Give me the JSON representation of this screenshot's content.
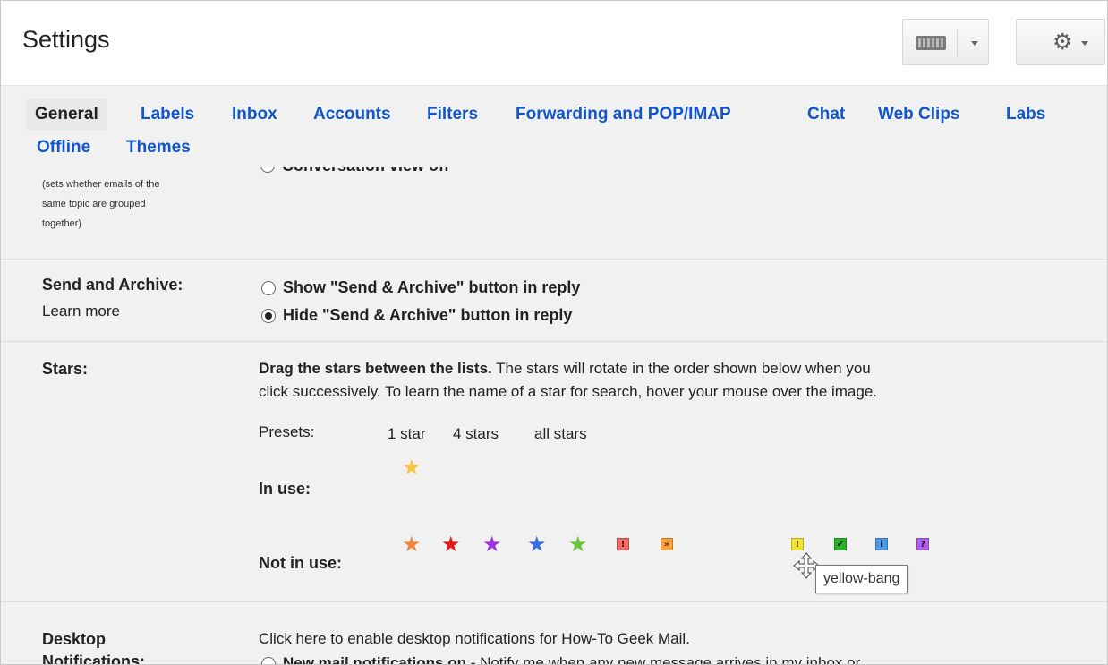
{
  "header": {
    "title": "Settings"
  },
  "icons": {
    "keyboard": "keyboard-icon",
    "gear": "gear-icon",
    "caret": "chevron-down-icon"
  },
  "tabs": [
    {
      "label": "General",
      "active": true
    },
    {
      "label": "Labels"
    },
    {
      "label": "Inbox"
    },
    {
      "label": "Accounts"
    },
    {
      "label": "Filters"
    },
    {
      "label": "Forwarding and POP/IMAP"
    },
    {
      "label": "Chat"
    },
    {
      "label": "Web Clips"
    },
    {
      "label": "Labs"
    },
    {
      "label": "Offline"
    },
    {
      "label": "Themes"
    }
  ],
  "conversation": {
    "option_cut": "Conversation view off",
    "description": [
      "(sets whether emails of the",
      "same topic are grouped",
      "together)"
    ]
  },
  "send_archive": {
    "label": "Send and Archive:",
    "learn_more": "Learn more",
    "options": [
      {
        "label": "Show \"Send & Archive\" button in reply",
        "selected": false
      },
      {
        "label": "Hide \"Send & Archive\" button in reply",
        "selected": true
      }
    ]
  },
  "stars": {
    "label": "Stars:",
    "instruction_bold": "Drag the stars between the lists.",
    "instruction_rest": " The stars will rotate in the order shown below when you",
    "instruction_line2": "click successively. To learn the name of a star for search, hover your mouse over the image.",
    "presets_label": "Presets:",
    "presets": [
      "1 star",
      "4 stars",
      "all stars"
    ],
    "in_use_label": "In use:",
    "not_in_use_label": "Not in use:",
    "in_use": [
      {
        "name": "yellow-star",
        "color": "#f6c345"
      }
    ],
    "not_in_use": [
      {
        "name": "orange-star",
        "color": "#f3873d",
        "glyph": "★"
      },
      {
        "name": "red-star",
        "color": "#e81919",
        "glyph": "★"
      },
      {
        "name": "purple-star",
        "color": "#9b32dc",
        "glyph": "★"
      },
      {
        "name": "blue-star",
        "color": "#3a6fe0",
        "glyph": "★"
      },
      {
        "name": "green-star",
        "color": "#69c53a",
        "glyph": "★"
      },
      {
        "name": "red-bang",
        "color": "#f26b6b",
        "glyph": "!"
      },
      {
        "name": "orange-guillemet",
        "color": "#f9a33c",
        "glyph": "»"
      },
      {
        "name": "yellow-bang",
        "color": "#f4e12f",
        "glyph": "!"
      },
      {
        "name": "green-check",
        "color": "#2bb02b",
        "glyph": "✔"
      },
      {
        "name": "blue-info",
        "color": "#4c9ae8",
        "glyph": "i"
      },
      {
        "name": "purple-question",
        "color": "#b260e8",
        "glyph": "?"
      }
    ],
    "tooltip": "yellow-bang"
  },
  "desktop": {
    "label_line1": "Desktop",
    "label_line2": "Notifications:",
    "enable_link": "Click here to enable desktop notifications for How-To Geek Mail.",
    "option_bold": "New mail notifications on",
    "option_rest": " - Notify me when any new message arrives in my inbox or"
  }
}
